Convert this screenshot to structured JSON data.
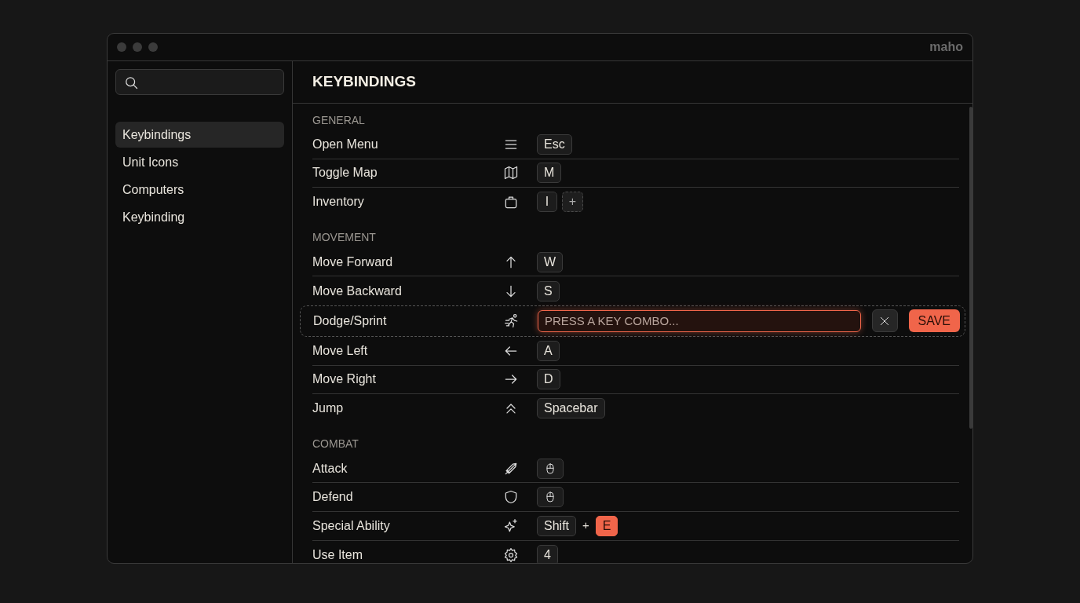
{
  "window": {
    "brand": "maho"
  },
  "sidebar": {
    "items": [
      {
        "label": "Keybindings",
        "selected": true
      },
      {
        "label": "Unit Icons",
        "selected": false
      },
      {
        "label": "Computers",
        "selected": false
      },
      {
        "label": "Keybinding",
        "selected": false
      }
    ]
  },
  "main": {
    "title": "KEYBINDINGS",
    "sections": [
      {
        "heading": "GENERAL",
        "rows": [
          {
            "label": "Open Menu",
            "editing": false,
            "keys": [
              {
                "kind": "key",
                "label": "Esc",
                "highlighted": false
              }
            ]
          },
          {
            "label": "Toggle Map",
            "editing": false,
            "keys": [
              {
                "kind": "key",
                "label": "M",
                "highlighted": false
              }
            ]
          },
          {
            "label": "Inventory",
            "editing": false,
            "keys": [
              {
                "kind": "key",
                "label": "I",
                "highlighted": false
              },
              {
                "kind": "add",
                "label": "+"
              }
            ]
          }
        ]
      },
      {
        "heading": "MOVEMENT",
        "rows": [
          {
            "label": "Move Forward",
            "editing": false,
            "keys": [
              {
                "kind": "key",
                "label": "W",
                "highlighted": false
              }
            ]
          },
          {
            "label": "Move Backward",
            "editing": false,
            "keys": [
              {
                "kind": "key",
                "label": "S",
                "highlighted": false
              }
            ]
          },
          {
            "label": "Dodge/Sprint",
            "editing": true,
            "editor": {
              "placeholder": "PRESS A KEY COMBO...",
              "save_label": "SAVE"
            }
          },
          {
            "label": "Move Left",
            "editing": false,
            "keys": [
              {
                "kind": "key",
                "label": "A",
                "highlighted": false
              }
            ]
          },
          {
            "label": "Move Right",
            "editing": false,
            "keys": [
              {
                "kind": "key",
                "label": "D",
                "highlighted": false
              }
            ]
          },
          {
            "label": "Jump",
            "editing": false,
            "keys": [
              {
                "kind": "key",
                "label": "Spacebar",
                "highlighted": false
              }
            ]
          }
        ]
      },
      {
        "heading": "COMBAT",
        "rows": [
          {
            "label": "Attack",
            "editing": false,
            "keys": [
              {
                "kind": "mouse"
              }
            ]
          },
          {
            "label": "Defend",
            "editing": false,
            "keys": [
              {
                "kind": "mouse"
              }
            ]
          },
          {
            "label": "Special Ability",
            "editing": false,
            "keys": [
              {
                "kind": "key",
                "label": "Shift",
                "highlighted": false
              },
              {
                "kind": "joiner",
                "label": "+"
              },
              {
                "kind": "key",
                "label": "E",
                "highlighted": true
              }
            ]
          },
          {
            "label": "Use Item",
            "editing": false,
            "keys": [
              {
                "kind": "key",
                "label": "4",
                "highlighted": false
              }
            ]
          }
        ]
      }
    ]
  }
}
